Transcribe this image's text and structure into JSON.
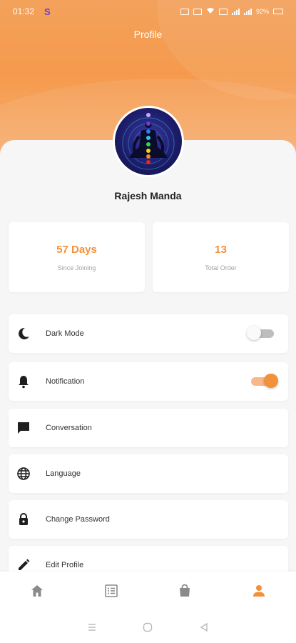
{
  "status_bar": {
    "time": "01:32",
    "app_indicator": "S",
    "battery": "92%"
  },
  "header": {
    "title": "Profile"
  },
  "user": {
    "name": "Rajesh Manda"
  },
  "stats": [
    {
      "value": "57 Days",
      "label": "Since Joining"
    },
    {
      "value": "13",
      "label": "Total Order"
    }
  ],
  "menu": [
    {
      "label": "Dark Mode",
      "icon": "moon-icon",
      "toggle": false
    },
    {
      "label": "Notification",
      "icon": "bell-icon",
      "toggle": true
    },
    {
      "label": "Conversation",
      "icon": "chat-icon"
    },
    {
      "label": "Language",
      "icon": "globe-icon"
    },
    {
      "label": "Change Password",
      "icon": "lock-icon"
    },
    {
      "label": "Edit Profile",
      "icon": "pencil-icon"
    }
  ],
  "bottom_nav": [
    {
      "icon": "home-icon",
      "active": false
    },
    {
      "icon": "orders-list-icon",
      "active": false
    },
    {
      "icon": "shopping-bag-icon",
      "active": false
    },
    {
      "icon": "person-icon",
      "active": true
    }
  ],
  "colors": {
    "accent": "#f3913b",
    "inactive_icon": "#8a8a8a",
    "header_gradient_top": "#f3a15b"
  }
}
